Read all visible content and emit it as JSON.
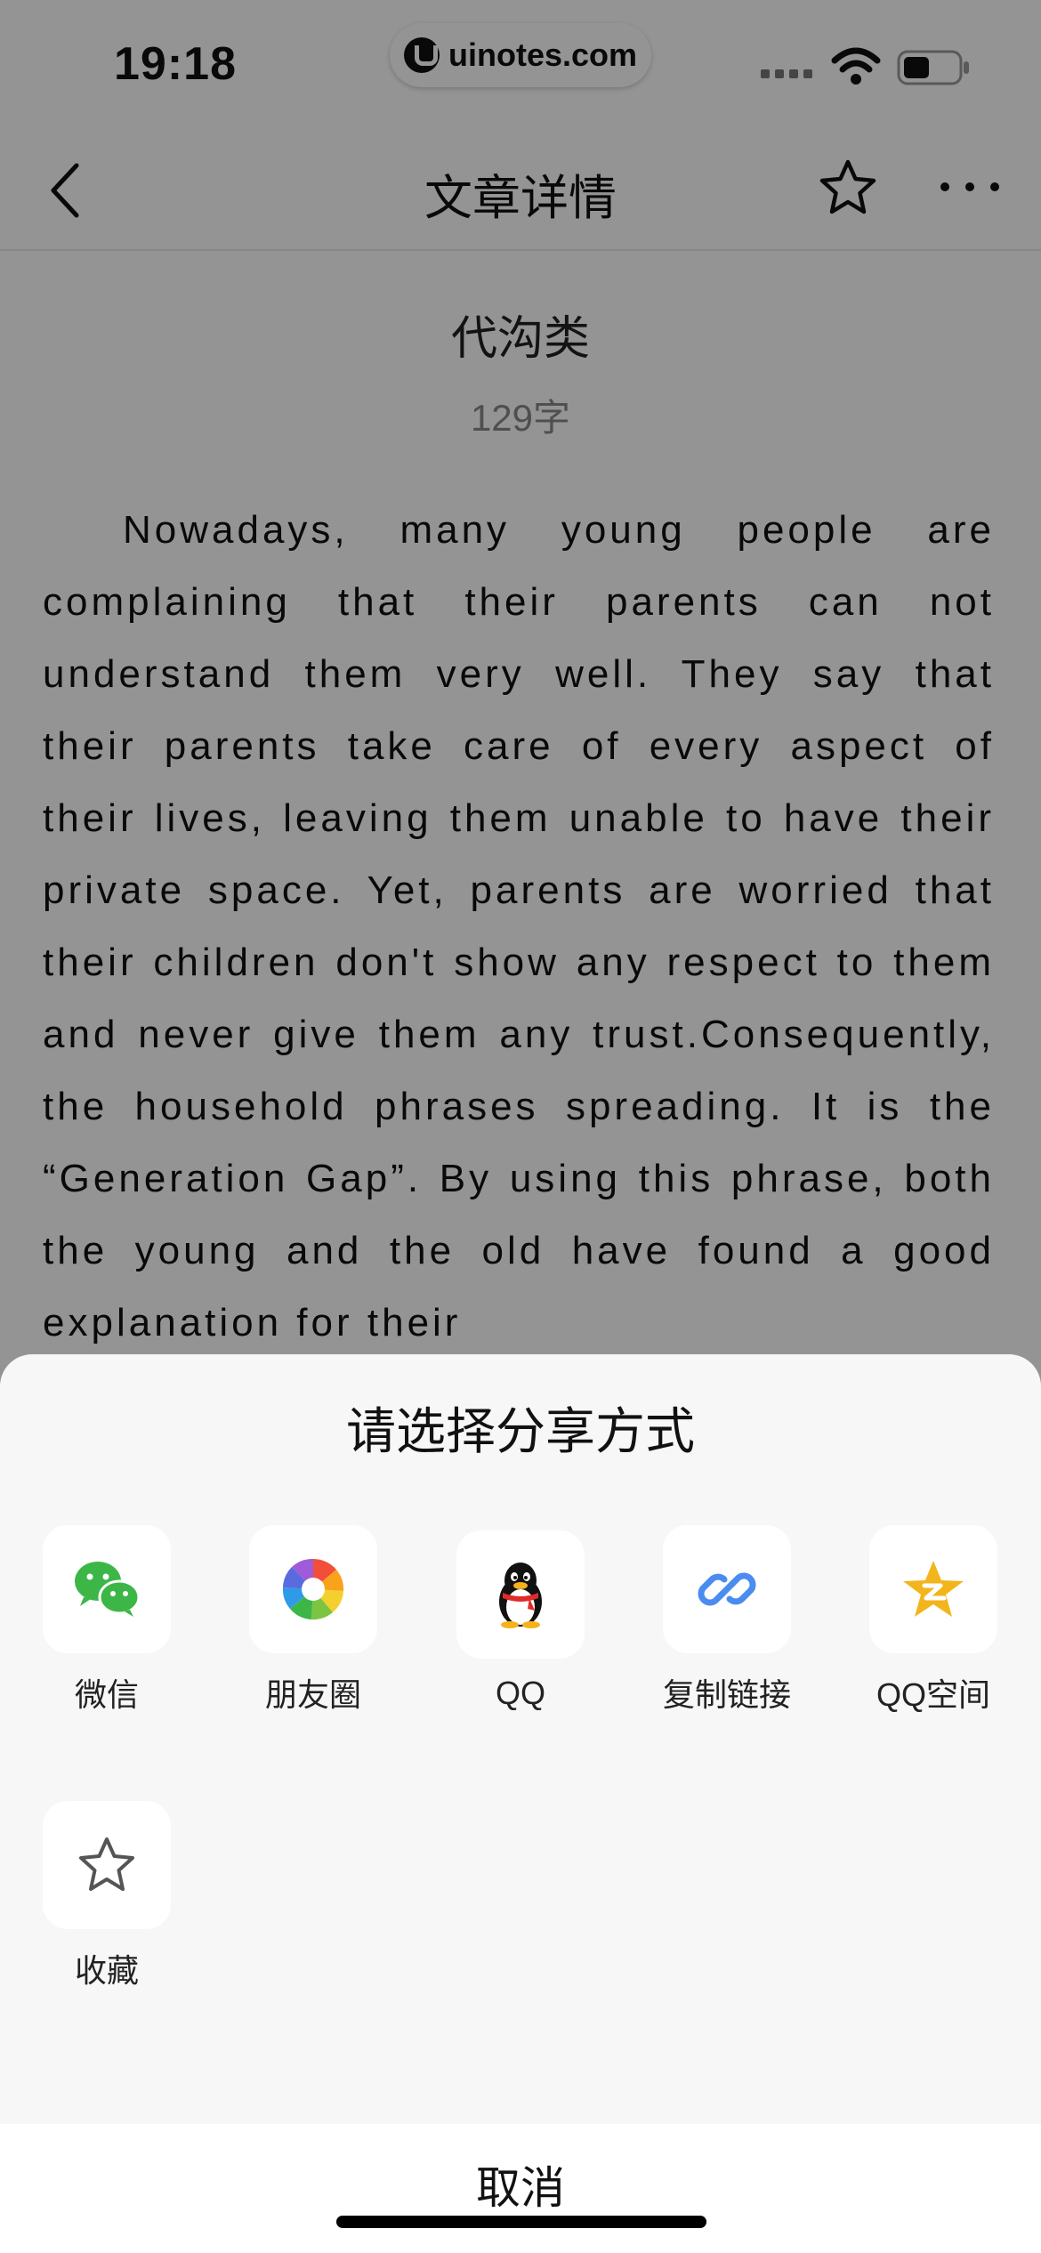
{
  "status_bar": {
    "time": "19:18",
    "watermark": "uinotes.com"
  },
  "nav": {
    "title": "文章详情"
  },
  "article": {
    "title": "代沟类",
    "word_count": "129字",
    "body": "Nowadays, many young people are complaining that their parents can not understand them very well. They say that their parents take care of every aspect of their lives, leaving them unable to have their private space. Yet, parents are worried that their children don't show any respect to them and never give them any trust.Consequently, the household phrases spreading. It is the “Generation Gap”. By using this phrase, both the young and the old have found a good explanation for their"
  },
  "share_sheet": {
    "title": "请选择分享方式",
    "options": [
      {
        "label": "微信",
        "icon": "wechat-icon"
      },
      {
        "label": "朋友圈",
        "icon": "moments-icon"
      },
      {
        "label": "QQ",
        "icon": "qq-penguin-icon"
      },
      {
        "label": "复制链接",
        "icon": "link-icon"
      },
      {
        "label": "QQ空间",
        "icon": "qzone-star-icon"
      },
      {
        "label": "收藏",
        "icon": "star-outline-icon"
      }
    ],
    "cancel_label": "取消"
  },
  "colors": {
    "overlay": "rgba(0,0,0,0.42)",
    "sheet_bg": "#f7f7f7",
    "wechat_green": "#3DB648",
    "link_blue": "#4A8CF0",
    "qzone_gold": "#F2B51B"
  }
}
